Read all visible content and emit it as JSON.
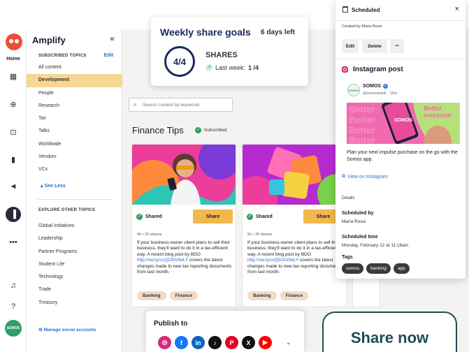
{
  "sidebar": {
    "brand": "Amplify",
    "collapse_icon": "«",
    "subscribed_heading": "SUBSCRIBED TOPICS",
    "edit_label": "Edit",
    "topics": [
      "All content",
      "Development",
      "People",
      "Research",
      "Tax",
      "Talks",
      "Worldwide",
      "Vendors",
      "VCs"
    ],
    "selected_topic": "Development",
    "see_less": "See Less",
    "explore_heading": "EXPLORE OTHER TOPICS",
    "other_topics": [
      "Global Initiatives",
      "Leadership",
      "Partner Programs",
      "Student Life",
      "Technology",
      "Trade",
      "Treasury"
    ],
    "manage_accounts": "Manage social accounts"
  },
  "rail": {
    "home_label": "Home",
    "avatar_label": "SOMOS",
    "icons": [
      "owl-logo-icon",
      "calendar-icon",
      "plus-circle-icon",
      "inbox-icon",
      "analytics-icon",
      "megaphone-icon",
      "amplify-icon",
      "more-icon",
      "bell-icon",
      "help-icon"
    ]
  },
  "main": {
    "search_placeholder": "Search content by keywords",
    "section_title": "Finance Tips",
    "subscribed_label": "Subscribed",
    "cards": [
      {
        "shared_label": "Shared",
        "share_button": "Share",
        "stats": "5h  •  20 shares",
        "body_before": "If your business-owner client plans to sell their business, they'll want to do it in a tax-efficient way. A recent blog post by BDO ",
        "link": "http://ow.ly/ccQD30zfwLY",
        "body_after": " covers the latest changes made to new tax reporting documents from last month.",
        "tags": [
          "Banking",
          "Finance"
        ]
      },
      {
        "shared_label": "Shared",
        "share_button": "Share",
        "stats": "5h  •  20 shares",
        "body_before": "If your business-owner client plans to sell their business, they'll want to do it in a tax-efficient way. A recent blog post by BDO ",
        "link": "http://ow.ly/ccQD30zfwLY",
        "body_after": " covers the latest changes made to new tax reporting documents from last month.",
        "tags": [
          "Banking",
          "Finance"
        ]
      }
    ]
  },
  "goals": {
    "title": "Weekly share goals",
    "days_left": "6 days left",
    "progress": "4/4",
    "unit": "SHARES",
    "last_week_label": "Last week:",
    "last_week_value": "1 /4"
  },
  "scheduled": {
    "title": "Scheduled",
    "close_icon": "×",
    "created_by": "Created by Maria Rossi",
    "buttons": {
      "edit": "Edit",
      "delete": "Delete",
      "more": "•••"
    },
    "post_type": "Instagram post",
    "account": {
      "name": "SOMOS",
      "handle": "@somosbank · 15m",
      "avatar": "SOMOS"
    },
    "image_text": "Better everyone",
    "image_brand": "SOMOS",
    "caption": "Plan your next impulse purchase on the go with the Somos app.",
    "view_link": "View on Instagram",
    "details_label": "Details",
    "scheduled_by_label": "Scheduled by",
    "scheduled_by_value": "Maria Rossi",
    "scheduled_time_label": "Scheduled time",
    "scheduled_time_value": "Monday, February 12 at 11:18am",
    "tags_label": "Tags",
    "tags": [
      "somos",
      "banking",
      "app"
    ]
  },
  "publish": {
    "title": "Publish to",
    "networks": [
      {
        "name": "instagram-icon",
        "glyph": "◎",
        "color": "#d6297a"
      },
      {
        "name": "facebook-icon",
        "glyph": "f",
        "color": "#1877f2"
      },
      {
        "name": "linkedin-icon",
        "glyph": "in",
        "color": "#0a66c2"
      },
      {
        "name": "tiktok-icon",
        "glyph": "♪",
        "color": "#111111"
      },
      {
        "name": "pinterest-icon",
        "glyph": "P",
        "color": "#e60023"
      },
      {
        "name": "x-icon",
        "glyph": "X",
        "color": "#111111"
      },
      {
        "name": "youtube-icon",
        "glyph": "▶",
        "color": "#ff0000"
      }
    ],
    "share_now": "Share now"
  },
  "colors": {
    "accent": "#f2b84b",
    "selected_topic_bg": "#f7d794",
    "navy": "#1a2a5e",
    "link": "#2e6bd1",
    "share_now_border": "#1d4d52"
  }
}
